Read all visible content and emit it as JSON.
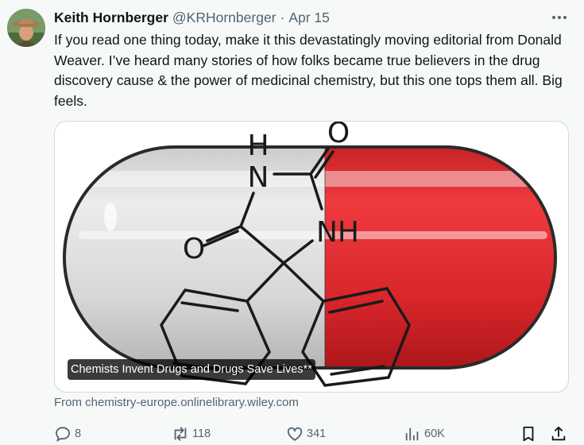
{
  "tweet": {
    "author_name": "Keith Hornberger",
    "handle": "@KRHornberger",
    "separator": "·",
    "date": "Apr 15",
    "text": "If you read one thing today, make it this devastatingly moving editorial from Donald Weaver. I’ve heard many stories of how folks became true believers in the drug discovery cause & the power of medicinal chemistry, but this one tops them all. Big feels.",
    "card": {
      "caption": "Chemists Invent Drugs and Drugs Save Lives**",
      "source": "From chemistry-europe.onlinelibrary.wiley.com",
      "molecule_labels": {
        "o_top": "O",
        "h_top": "H",
        "n_left": "N",
        "nh": "NH",
        "o_left": "O"
      }
    },
    "actions": {
      "replies": "8",
      "reposts": "118",
      "likes": "341",
      "views": "60K"
    }
  },
  "colors": {
    "capsule_red": "#e3262b",
    "capsule_grey": "#dcdcdc",
    "secondary_text": "#536471"
  },
  "icons": [
    "more-icon",
    "reply-icon",
    "repost-icon",
    "like-icon",
    "views-icon",
    "bookmark-icon",
    "share-icon"
  ]
}
